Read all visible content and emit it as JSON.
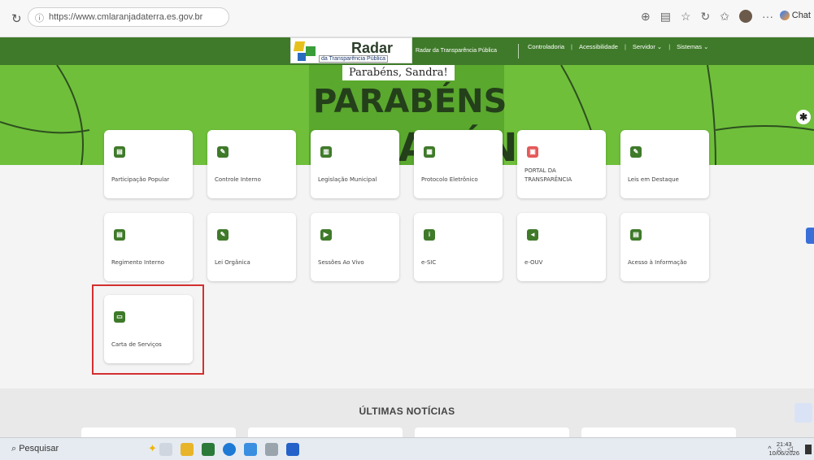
{
  "browser": {
    "url": "https://www.cmlaranjadaterra.es.gov.br",
    "chat_label": "Chat"
  },
  "header": {
    "logo_title": "Radar",
    "logo_subtitle": "da Transparência Pública",
    "portal_name": "Radar da Transparência Pública",
    "nav": [
      "Controladoria",
      "Acessibilidade",
      "Servidor ⌄",
      "Sistemas ⌄"
    ]
  },
  "hero": {
    "greeting": "Parabéns, Sandra!"
  },
  "services": [
    {
      "label": "Participação Popular",
      "icon": "doc-icon"
    },
    {
      "label": "Controle Interno",
      "icon": "doc-edit-icon"
    },
    {
      "label": "Legislação Municipal",
      "icon": "book-icon"
    },
    {
      "label": "Protocolo Eletrônico",
      "icon": "file-icon"
    },
    {
      "label": "PORTAL DA TRANSPARÊNCIA",
      "icon": "chart-doc-icon"
    },
    {
      "label": "Leis em Destaque",
      "icon": "doc-edit-icon"
    },
    {
      "label": "Regimento Interno",
      "icon": "doc-icon"
    },
    {
      "label": "Lei Orgânica",
      "icon": "doc-edit-icon"
    },
    {
      "label": "Sessões Ao Vivo",
      "icon": "video-icon"
    },
    {
      "label": "e-SIC",
      "icon": "info-icon"
    },
    {
      "label": "e-OUV",
      "icon": "megaphone-icon"
    },
    {
      "label": "Acesso à Informação",
      "icon": "doc-info-icon"
    },
    {
      "label": "Carta de Serviços",
      "icon": "inbox-icon"
    }
  ],
  "news": {
    "title": "ÚLTIMAS NOTÍCIAS"
  },
  "taskbar": {
    "search_placeholder": "Pesquisar",
    "time": "21:43",
    "date": "10/06/2026"
  },
  "colors": {
    "header_green": "#3f7a2a",
    "hero_green": "#6fbf3b",
    "highlight_red": "#d32f2f"
  }
}
